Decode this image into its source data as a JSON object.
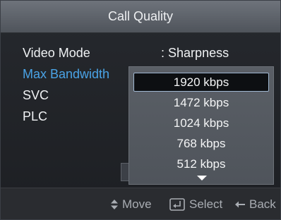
{
  "window": {
    "title": "Call Quality"
  },
  "settings": [
    {
      "label": "Video Mode",
      "value": "Sharpness",
      "active": false
    },
    {
      "label": "Max Bandwidth",
      "active": true
    },
    {
      "label": "SVC",
      "active": false
    },
    {
      "label": "PLC",
      "active": false
    }
  ],
  "value_prefix": ":",
  "dropdown": {
    "options": [
      "1920 kbps",
      "1472 kbps",
      "1024 kbps",
      "768 kbps",
      "512 kbps"
    ],
    "selected": "1920 kbps"
  },
  "footer": {
    "move_label": "Move",
    "select_label": "Select",
    "back_label": "Back"
  },
  "colors": {
    "active_label": "#4aa3e6",
    "text": "#f0f2f4",
    "hint_text": "#a9adb3"
  }
}
